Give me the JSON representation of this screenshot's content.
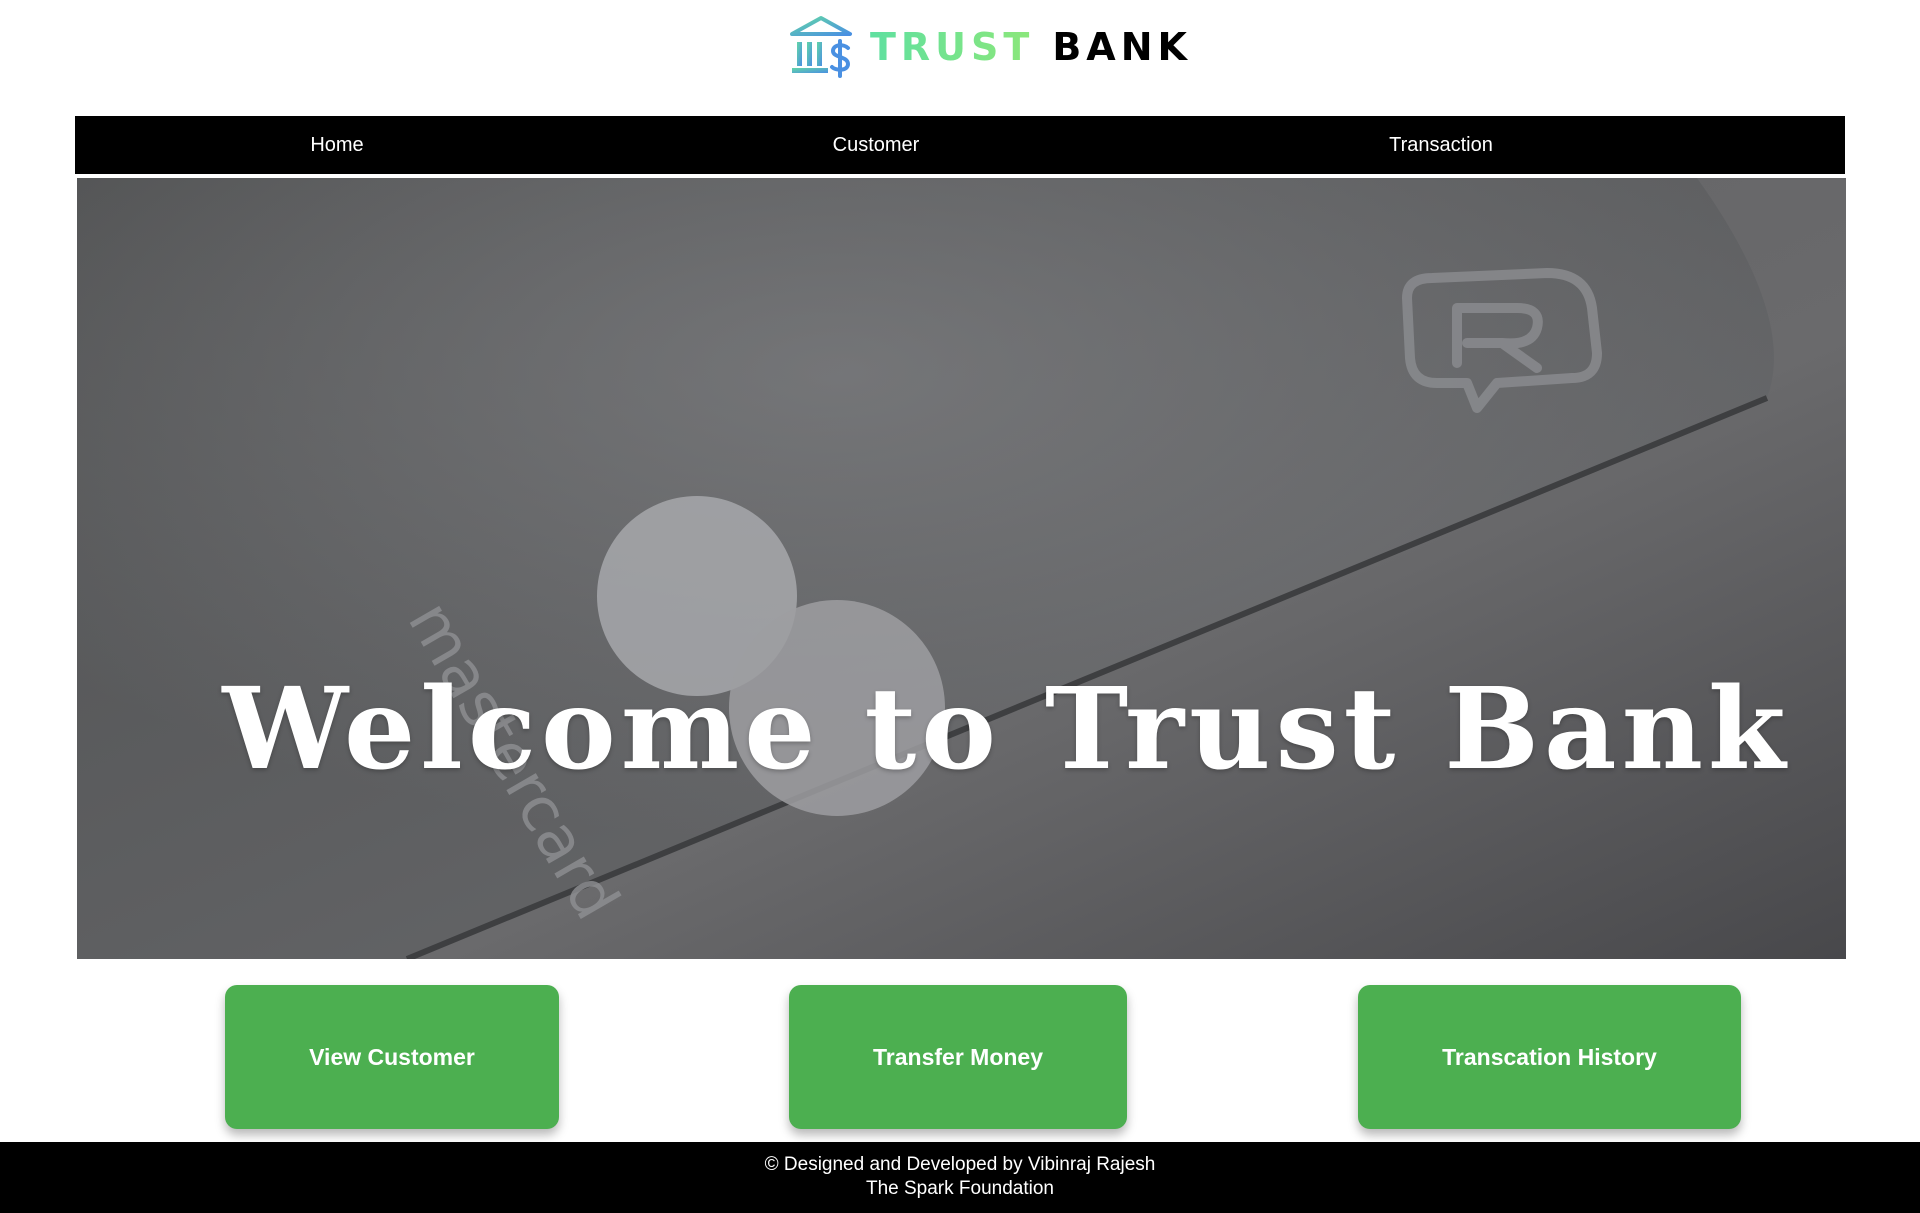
{
  "header": {
    "logo_word_1": "TRUST",
    "logo_word_2": "BANK",
    "logo_icon": "bank-building-dollar-icon",
    "logo_colors": [
      "#5fe0a0",
      "#4a90e2",
      "#000000"
    ]
  },
  "nav": {
    "items": [
      {
        "label": "Home"
      },
      {
        "label": "Customer"
      },
      {
        "label": "Transaction"
      }
    ]
  },
  "hero": {
    "title": "Welcome to Trust Bank",
    "card_brand_text": "mastercard"
  },
  "actions": {
    "view_customer": "View Customer",
    "transfer_money": "Transfer Money",
    "transaction_history": "Transcation History",
    "button_color": "#4caf50"
  },
  "footer": {
    "line_1": "© Designed and Developed by Vibinraj Rajesh",
    "line_2": "The Spark Foundation"
  }
}
